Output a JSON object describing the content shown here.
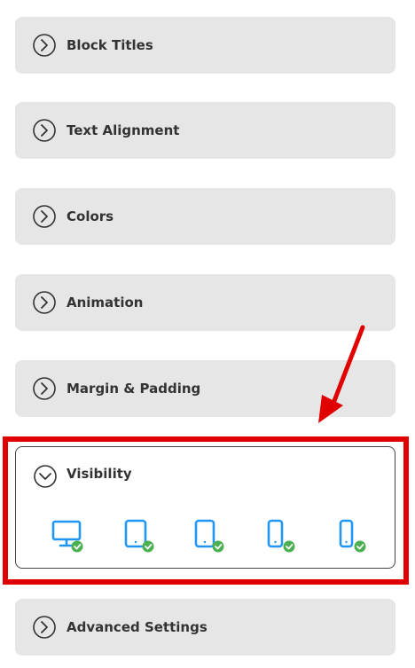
{
  "panels": {
    "block_titles": "Block Titles",
    "text_alignment": "Text Alignment",
    "colors": "Colors",
    "animation": "Animation",
    "margin_padding": "Margin & Padding",
    "visibility": "Visibility",
    "advanced_settings": "Advanced Settings"
  },
  "visibility_devices": [
    "desktop-visible",
    "tablet-visible",
    "tablet-small-visible",
    "mobile-visible",
    "mobile-small-visible"
  ],
  "colors": {
    "panel_bg": "#e6e6e6",
    "highlight_red": "#e10000",
    "device_blue": "#2196f3",
    "check_green": "#4caf50"
  }
}
